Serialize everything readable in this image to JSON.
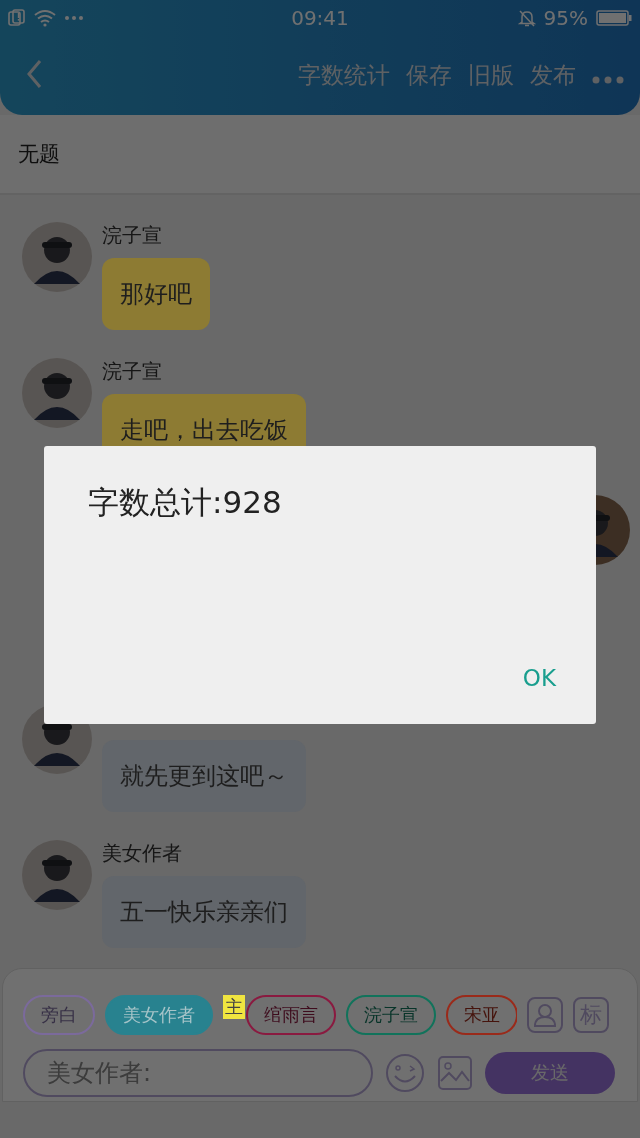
{
  "status_bar": {
    "time": "09:41",
    "battery": "95%"
  },
  "header": {
    "actions": [
      "字数统计",
      "保存",
      "旧版",
      "发布"
    ]
  },
  "title": "无题",
  "messages": [
    {
      "kind": "left",
      "name": "浣子宣",
      "text": "那好吧",
      "color": "#8d7b33"
    },
    {
      "kind": "left",
      "name": "浣子宣",
      "text": "走吧，出去吃饭",
      "color": "#8d7b33"
    },
    {
      "kind": "right"
    },
    {
      "kind": "left",
      "text": "就先更到这吧～",
      "color": "#62666b"
    },
    {
      "kind": "left",
      "name": "美女作者",
      "text": "五一快乐亲亲们",
      "color": "#62666b"
    }
  ],
  "roles": [
    {
      "label": "旁白",
      "color": "#7b6a9c",
      "selected": false
    },
    {
      "label": "美女作者",
      "color": "#28828f",
      "selected": true
    },
    {
      "label": "绾雨言",
      "color": "#8a1a40",
      "selected": false,
      "badge": "主"
    },
    {
      "label": "浣子宣",
      "color": "#11735b",
      "selected": false
    },
    {
      "label": "宋亚",
      "color": "#9a2a1a",
      "selected": false
    }
  ],
  "tag_button": "标",
  "input": {
    "placeholder": "美女作者:"
  },
  "send_button": "发送",
  "dialog": {
    "message": "字数总计:928",
    "button": "OK"
  }
}
